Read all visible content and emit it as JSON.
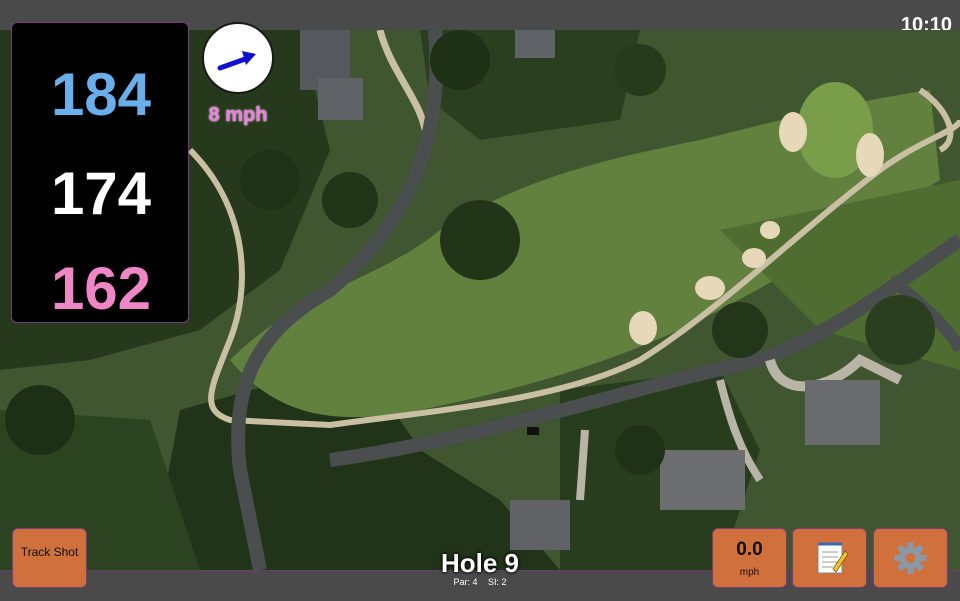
{
  "clock": "10:10",
  "distances": {
    "back": "184",
    "middle": "174",
    "front": "162"
  },
  "wind": {
    "speed": "8 mph",
    "direction_icon": "wind-arrow-icon"
  },
  "hole": {
    "title": "Hole 9",
    "par": "Par: 4",
    "stroke_index": "SI: 2"
  },
  "buttons": {
    "track_shot": "Track Shot",
    "speed_value": "0.0",
    "speed_unit": "mph",
    "notes_icon": "notepad-icon",
    "settings_icon": "gear-icon"
  },
  "colors": {
    "back": "#6aaeea",
    "middle": "#ffffff",
    "front": "#ef86c6",
    "wind_text": "#f07ee0",
    "button": "#d0703c"
  }
}
